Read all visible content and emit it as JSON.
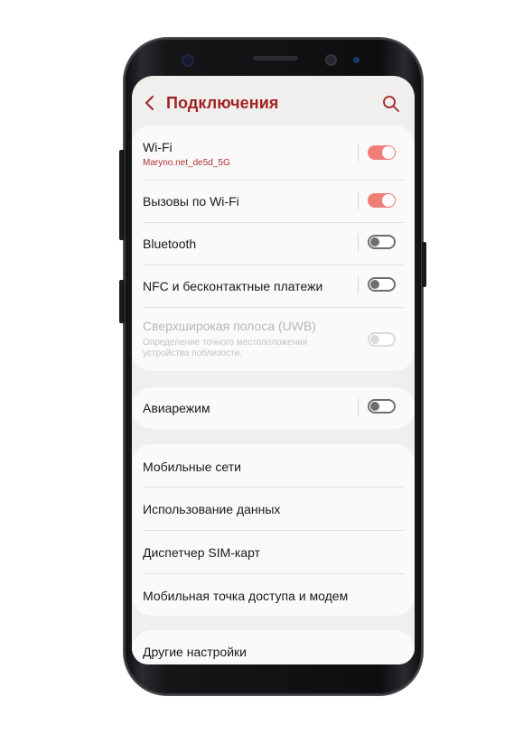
{
  "header": {
    "title": "Подключения",
    "back_icon": "chevron-left-icon",
    "search_icon": "search-icon"
  },
  "colors": {
    "accent": "#a02222",
    "toggle_on": "#f07d76",
    "background": "#f1eeee"
  },
  "connections": [
    {
      "label": "Wi-Fi",
      "subtitle": "Maryno.net_de5d_5G",
      "toggle": "on"
    },
    {
      "label": "Вызовы по Wi-Fi",
      "toggle": "on"
    },
    {
      "label": "Bluetooth",
      "toggle": "off"
    },
    {
      "label": "NFC и бесконтактные платежи",
      "toggle": "off"
    },
    {
      "label": "Сверхширокая полоса (UWB)",
      "subtitle_line1": "Определение точного местоположения",
      "subtitle_line2": "устройства поблизости.",
      "toggle": "disabled"
    }
  ],
  "airplane": {
    "label": "Авиарежим",
    "toggle": "off"
  },
  "network": [
    {
      "label": "Мобильные сети"
    },
    {
      "label": "Использование данных"
    },
    {
      "label": "Диспетчер SIM-карт"
    },
    {
      "label": "Мобильная точка доступа и модем"
    }
  ],
  "more": {
    "label": "Другие настройки"
  }
}
